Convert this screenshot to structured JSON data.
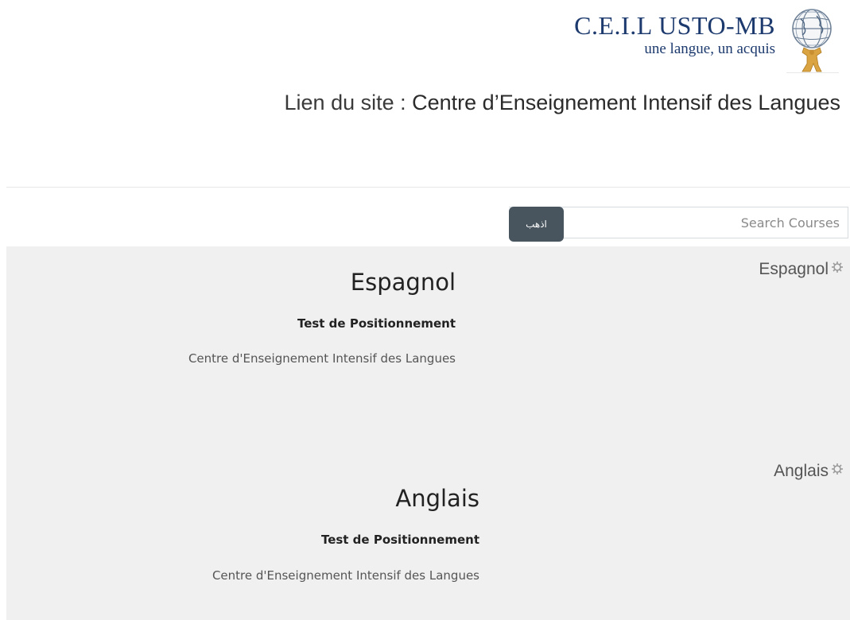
{
  "header": {
    "logo_title": "C.E.I.L USTO-MB",
    "logo_tagline": "une langue, un acquis",
    "site_link_prefix": "Lien du site  : ",
    "site_link_name": "Centre d’Enseignement Intensif des Langues"
  },
  "search": {
    "button_label": "اذهب",
    "placeholder": "Search Courses"
  },
  "courses": [
    {
      "tag": "Espagnol",
      "title": "Espagnol",
      "subtitle": "Test de Positionnement",
      "category": "Centre d'Enseignement Intensif des Langues"
    },
    {
      "tag": "Anglais",
      "title": "Anglais",
      "subtitle": "Test de Positionnement",
      "category": "Centre d'Enseignement Intensif des Langues"
    }
  ],
  "colors": {
    "logo_text": "#1d3a6e",
    "search_button": "#48555f",
    "panel_background": "#f0f0f0"
  },
  "icons": {
    "logo": "globe-atlas-emblem",
    "course_tag": "gear-icon"
  }
}
